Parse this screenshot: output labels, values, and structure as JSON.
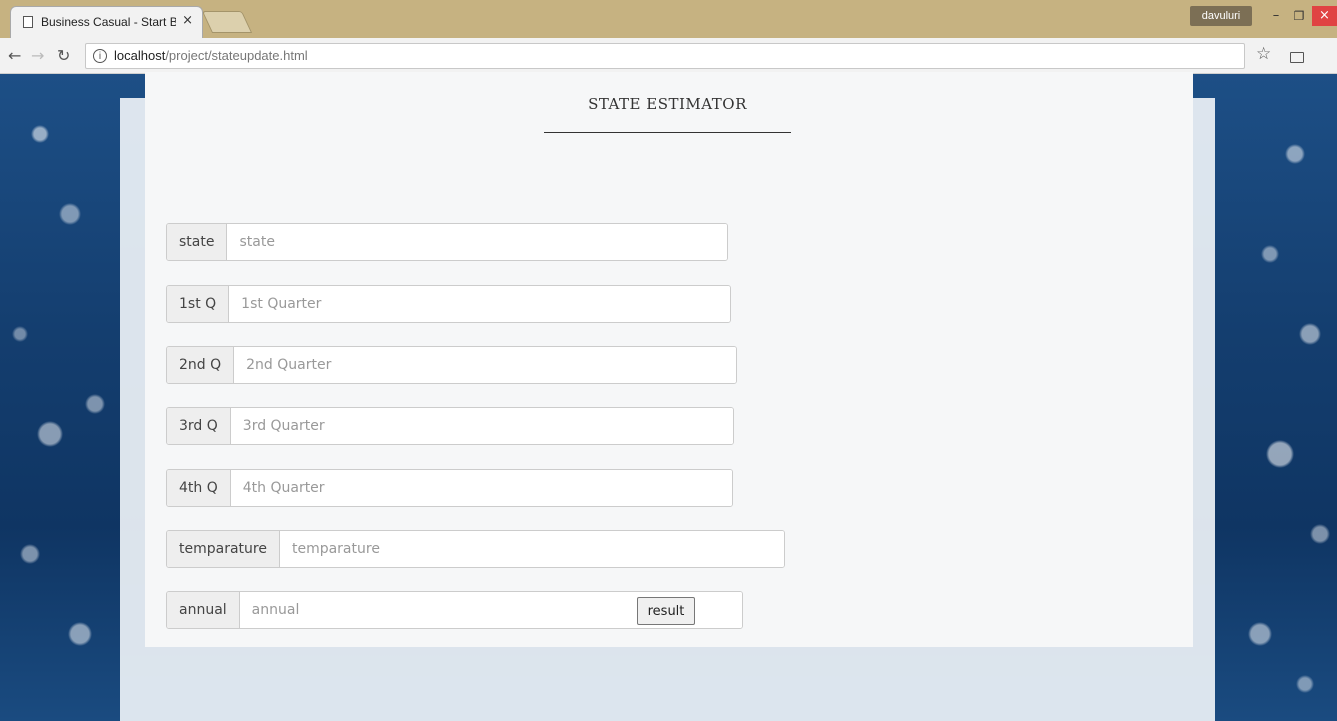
{
  "browser": {
    "tab_title": "Business Casual - Start B",
    "tab_close": "×",
    "url_host": "localhost",
    "url_path": "/project/stateupdate.html",
    "profile_name": "davuluri",
    "info_glyph": "i",
    "icons": [
      "page-icon",
      "close-icon",
      "back-icon",
      "forward-icon",
      "reload-icon",
      "info-icon",
      "star-icon",
      "cast-icon"
    ]
  },
  "page": {
    "title": "STATE ESTIMATOR",
    "fields": [
      {
        "label": "state",
        "placeholder": "state"
      },
      {
        "label": "1st Q",
        "placeholder": "1st Quarter"
      },
      {
        "label": "2nd Q",
        "placeholder": "2nd Quarter"
      },
      {
        "label": "3rd Q",
        "placeholder": "3rd Quarter"
      },
      {
        "label": "4th Q",
        "placeholder": "4th Quarter"
      },
      {
        "label": "temparature",
        "placeholder": "temparature"
      },
      {
        "label": "annual",
        "placeholder": "annual"
      }
    ],
    "submit_label": "result"
  },
  "colors": {
    "tabstrip": "#c6b281",
    "background": "#143e6f",
    "close_button": "#e04343"
  }
}
